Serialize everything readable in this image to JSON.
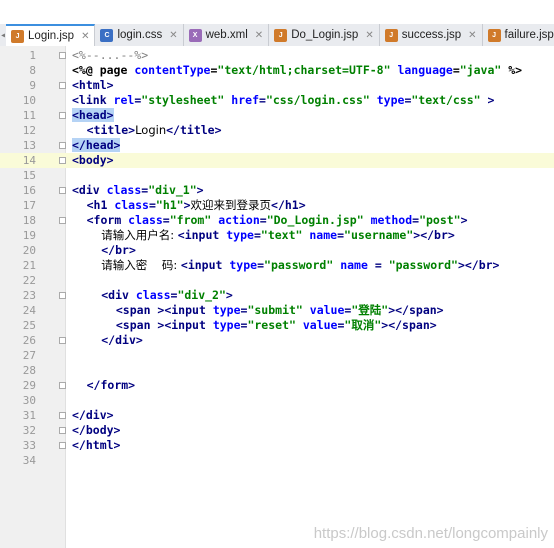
{
  "tabs": [
    {
      "label": "Login.jsp",
      "icon": "jsp-file-icon",
      "active": true
    },
    {
      "label": "login.css",
      "icon": "css-file-icon",
      "active": false
    },
    {
      "label": "web.xml",
      "icon": "xml-file-icon",
      "active": false
    },
    {
      "label": "Do_Login.jsp",
      "icon": "jsp-file-icon",
      "active": false
    },
    {
      "label": "success.jsp",
      "icon": "jsp-file-icon",
      "active": false
    },
    {
      "label": "failure.jsp",
      "icon": "jsp-file-icon",
      "active": false
    }
  ],
  "lines": [
    {
      "n": "1",
      "parts": [
        [
          "cmt",
          "<%--...--%>"
        ]
      ]
    },
    {
      "n": "8",
      "parts": [
        [
          "dir",
          "<%@ page "
        ],
        [
          "attr",
          "contentType"
        ],
        [
          "dir",
          "="
        ],
        [
          "str",
          "\"text/html;charset=UTF-8\""
        ],
        [
          "dir",
          " "
        ],
        [
          "attr",
          "language"
        ],
        [
          "dir",
          "="
        ],
        [
          "str",
          "\"java\""
        ],
        [
          "dir",
          " %>"
        ]
      ]
    },
    {
      "n": "9",
      "parts": [
        [
          "tag",
          "<html>"
        ]
      ]
    },
    {
      "n": "10",
      "parts": [
        [
          "tag",
          "<link "
        ],
        [
          "attr",
          "rel"
        ],
        [
          "tag",
          "="
        ],
        [
          "str",
          "\"stylesheet\""
        ],
        [
          "tag",
          " "
        ],
        [
          "attr",
          "href"
        ],
        [
          "tag",
          "="
        ],
        [
          "str",
          "\"css/login.css\""
        ],
        [
          "tag",
          " "
        ],
        [
          "attr",
          "type"
        ],
        [
          "tag",
          "="
        ],
        [
          "str",
          "\"text/css\""
        ],
        [
          "tag",
          " >"
        ]
      ]
    },
    {
      "n": "11",
      "parts": [
        [
          "tag hl",
          "<head>"
        ]
      ]
    },
    {
      "n": "12",
      "parts": [
        [
          "txt",
          "    "
        ],
        [
          "tag",
          "<title>"
        ],
        [
          "txt",
          "Login"
        ],
        [
          "tag",
          "</title>"
        ]
      ]
    },
    {
      "n": "13",
      "parts": [
        [
          "tag hl",
          "</head>"
        ]
      ]
    },
    {
      "n": "14",
      "parts": [
        [
          "tag",
          "<body>"
        ]
      ]
    },
    {
      "n": "15",
      "parts": []
    },
    {
      "n": "16",
      "parts": [
        [
          "tag",
          "<div "
        ],
        [
          "attr",
          "class"
        ],
        [
          "tag",
          "="
        ],
        [
          "str",
          "\"div_1\""
        ],
        [
          "tag",
          ">"
        ]
      ]
    },
    {
      "n": "17",
      "parts": [
        [
          "txt",
          "    "
        ],
        [
          "tag",
          "<h1 "
        ],
        [
          "attr",
          "class"
        ],
        [
          "tag",
          "="
        ],
        [
          "str",
          "\"h1\""
        ],
        [
          "tag",
          ">"
        ],
        [
          "txt",
          "欢迎来到登录页"
        ],
        [
          "tag",
          "</h1>"
        ]
      ]
    },
    {
      "n": "18",
      "parts": [
        [
          "txt",
          "    "
        ],
        [
          "tag",
          "<form "
        ],
        [
          "attr",
          "class"
        ],
        [
          "tag",
          "="
        ],
        [
          "str",
          "\"from\""
        ],
        [
          "tag",
          " "
        ],
        [
          "attr",
          "action"
        ],
        [
          "tag",
          "="
        ],
        [
          "str",
          "\"Do_Login.jsp\""
        ],
        [
          "tag",
          " "
        ],
        [
          "attr",
          "method"
        ],
        [
          "tag",
          "="
        ],
        [
          "str",
          "\"post\""
        ],
        [
          "tag",
          ">"
        ]
      ]
    },
    {
      "n": "19",
      "parts": [
        [
          "txt",
          "        请输入用户名: "
        ],
        [
          "tag",
          "<input "
        ],
        [
          "attr",
          "type"
        ],
        [
          "tag",
          "="
        ],
        [
          "str",
          "\"text\""
        ],
        [
          "tag",
          " "
        ],
        [
          "attr",
          "name"
        ],
        [
          "tag",
          "="
        ],
        [
          "str",
          "\"username\""
        ],
        [
          "tag",
          "></br>"
        ]
      ]
    },
    {
      "n": "20",
      "parts": [
        [
          "txt",
          "        "
        ],
        [
          "tag",
          "</br>"
        ]
      ]
    },
    {
      "n": "21",
      "parts": [
        [
          "txt",
          "        请输入密    码: "
        ],
        [
          "tag",
          "<input "
        ],
        [
          "attr",
          "type"
        ],
        [
          "tag",
          "="
        ],
        [
          "str",
          "\"password\""
        ],
        [
          "tag",
          " "
        ],
        [
          "attr",
          "name"
        ],
        [
          "tag",
          " = "
        ],
        [
          "str",
          "\"password\""
        ],
        [
          "tag",
          "></br>"
        ]
      ]
    },
    {
      "n": "22",
      "parts": []
    },
    {
      "n": "23",
      "parts": [
        [
          "txt",
          "        "
        ],
        [
          "tag",
          "<div "
        ],
        [
          "attr",
          "class"
        ],
        [
          "tag",
          "="
        ],
        [
          "str",
          "\"div_2\""
        ],
        [
          "tag",
          ">"
        ]
      ]
    },
    {
      "n": "24",
      "parts": [
        [
          "txt",
          "            "
        ],
        [
          "tag",
          "<span ><input "
        ],
        [
          "attr",
          "type"
        ],
        [
          "tag",
          "="
        ],
        [
          "str",
          "\"submit\""
        ],
        [
          "tag",
          " "
        ],
        [
          "attr",
          "value"
        ],
        [
          "tag",
          "="
        ],
        [
          "str",
          "\"登陆\""
        ],
        [
          "tag",
          "></span>"
        ]
      ]
    },
    {
      "n": "25",
      "parts": [
        [
          "txt",
          "            "
        ],
        [
          "tag",
          "<span ><input "
        ],
        [
          "attr",
          "type"
        ],
        [
          "tag",
          "="
        ],
        [
          "str",
          "\"reset\""
        ],
        [
          "tag",
          " "
        ],
        [
          "attr",
          "value"
        ],
        [
          "tag",
          "="
        ],
        [
          "str",
          "\"取消\""
        ],
        [
          "tag",
          "></span>"
        ]
      ]
    },
    {
      "n": "26",
      "parts": [
        [
          "txt",
          "        "
        ],
        [
          "tag",
          "</div>"
        ]
      ]
    },
    {
      "n": "27",
      "parts": []
    },
    {
      "n": "28",
      "parts": []
    },
    {
      "n": "29",
      "parts": [
        [
          "txt",
          "    "
        ],
        [
          "tag",
          "</form>"
        ]
      ]
    },
    {
      "n": "30",
      "parts": []
    },
    {
      "n": "31",
      "parts": [
        [
          "tag",
          "</div>"
        ]
      ]
    },
    {
      "n": "32",
      "parts": [
        [
          "tag",
          "</body>"
        ]
      ]
    },
    {
      "n": "33",
      "parts": [
        [
          "tag",
          "</html>"
        ]
      ]
    },
    {
      "n": "34",
      "parts": []
    }
  ],
  "watermark": "https://blog.csdn.net/longcompainly",
  "colors": {
    "tag": "#000080",
    "attribute": "#0000ff",
    "string": "#008000",
    "comment": "#808080",
    "tab_active_border": "#3c8fdf",
    "selection": "#b5d3f5"
  }
}
